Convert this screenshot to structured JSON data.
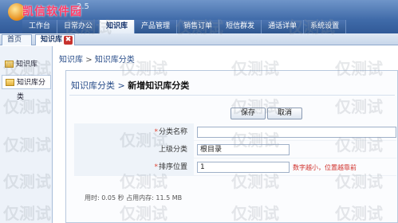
{
  "app": {
    "title": "凯信软件园",
    "version": "2.5"
  },
  "nav": {
    "items": [
      "工作台",
      "日常办公",
      "知识库",
      "产品管理",
      "销售订单",
      "短信群发",
      "通话详单",
      "系统设置"
    ],
    "active_index": 2
  },
  "tabs": {
    "items": [
      "首页",
      "知识库"
    ],
    "close_symbol": "✖"
  },
  "sidebar": {
    "items": [
      "知识库",
      "知识库分类"
    ]
  },
  "breadcrumb_top": {
    "part1": "知识库",
    "sep": ">",
    "part2": "知识库分类"
  },
  "breadcrumb_panel": {
    "part1": "知识库分类",
    "sep": ">",
    "part2": "新增知识库分类"
  },
  "buttons": {
    "save": "保存",
    "cancel": "取消"
  },
  "form": {
    "name_label": "分类名称",
    "name_value": "",
    "parent_label": "上级分类",
    "parent_value": "根目录",
    "order_label": "排序位置",
    "order_value": "1",
    "order_hint": "数字越小，位置越靠前",
    "required_mark": "*"
  },
  "status": {
    "text": "用时: 0.05 秒 占用内存: 11.5 MB"
  },
  "watermark": {
    "text": "仅测试"
  },
  "colors": {
    "header": "#3f6aa8",
    "accent": "#2a4e8a",
    "hint": "#d0302b"
  }
}
